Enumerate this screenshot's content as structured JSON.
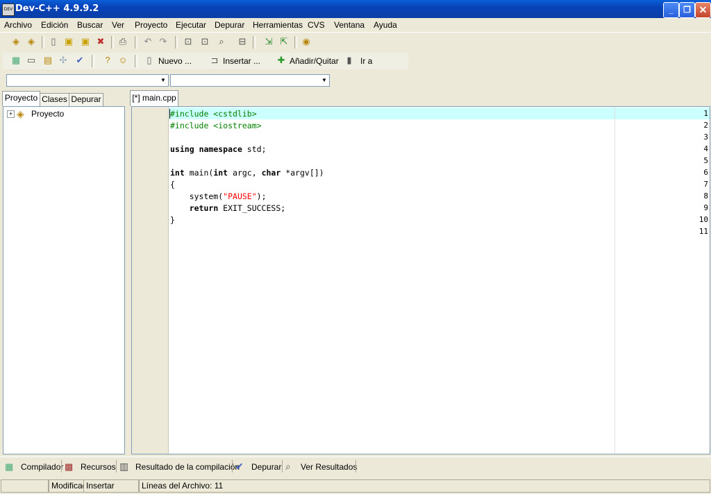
{
  "window": {
    "title": "Dev-C++ 4.9.9.2",
    "icon_text": "DEV"
  },
  "menu": [
    "Archivo",
    "Edición",
    "Buscar",
    "Ver",
    "Proyecto",
    "Ejecutar",
    "Depurar",
    "Herramientas",
    "CVS",
    "Ventana",
    "Ayuda"
  ],
  "toolbar2": {
    "new_label": "Nuevo ...",
    "insert_label": "Insertar ...",
    "addremove_label": "Añadir/Quitar",
    "goto_label": "Ir a"
  },
  "combos": {
    "class_value": "",
    "member_value": ""
  },
  "left_tabs": [
    "Proyecto",
    "Clases",
    "Depurar"
  ],
  "tree": {
    "root_label": "Proyecto",
    "expander": "+"
  },
  "editor": {
    "tab_label": "[*] main.cpp",
    "line_numbers": [
      "1",
      "2",
      "3",
      "4",
      "5",
      "6",
      "7",
      "8",
      "9",
      "10",
      "11"
    ],
    "code": [
      "#include <cstdlib>",
      "#include <iostream>",
      "",
      "using namespace std;",
      "",
      "int main(int argc, char *argv[])",
      "{",
      "    system(\"PAUSE\");",
      "    return EXIT_SUCCESS;",
      "}",
      ""
    ]
  },
  "bottom_tabs": [
    "Compilador",
    "Recursos",
    "Resultado de la compilación",
    "Depurar",
    "Ver Resultados"
  ],
  "status": {
    "modified": "Modificado",
    "mode": "Insertar",
    "lines": "Líneas del Archivo: 11"
  },
  "colors": {
    "titlebar": "#0a4fc8",
    "current_line": "#ccffff",
    "preprocessor": "#008000",
    "string": "#ff0000"
  }
}
